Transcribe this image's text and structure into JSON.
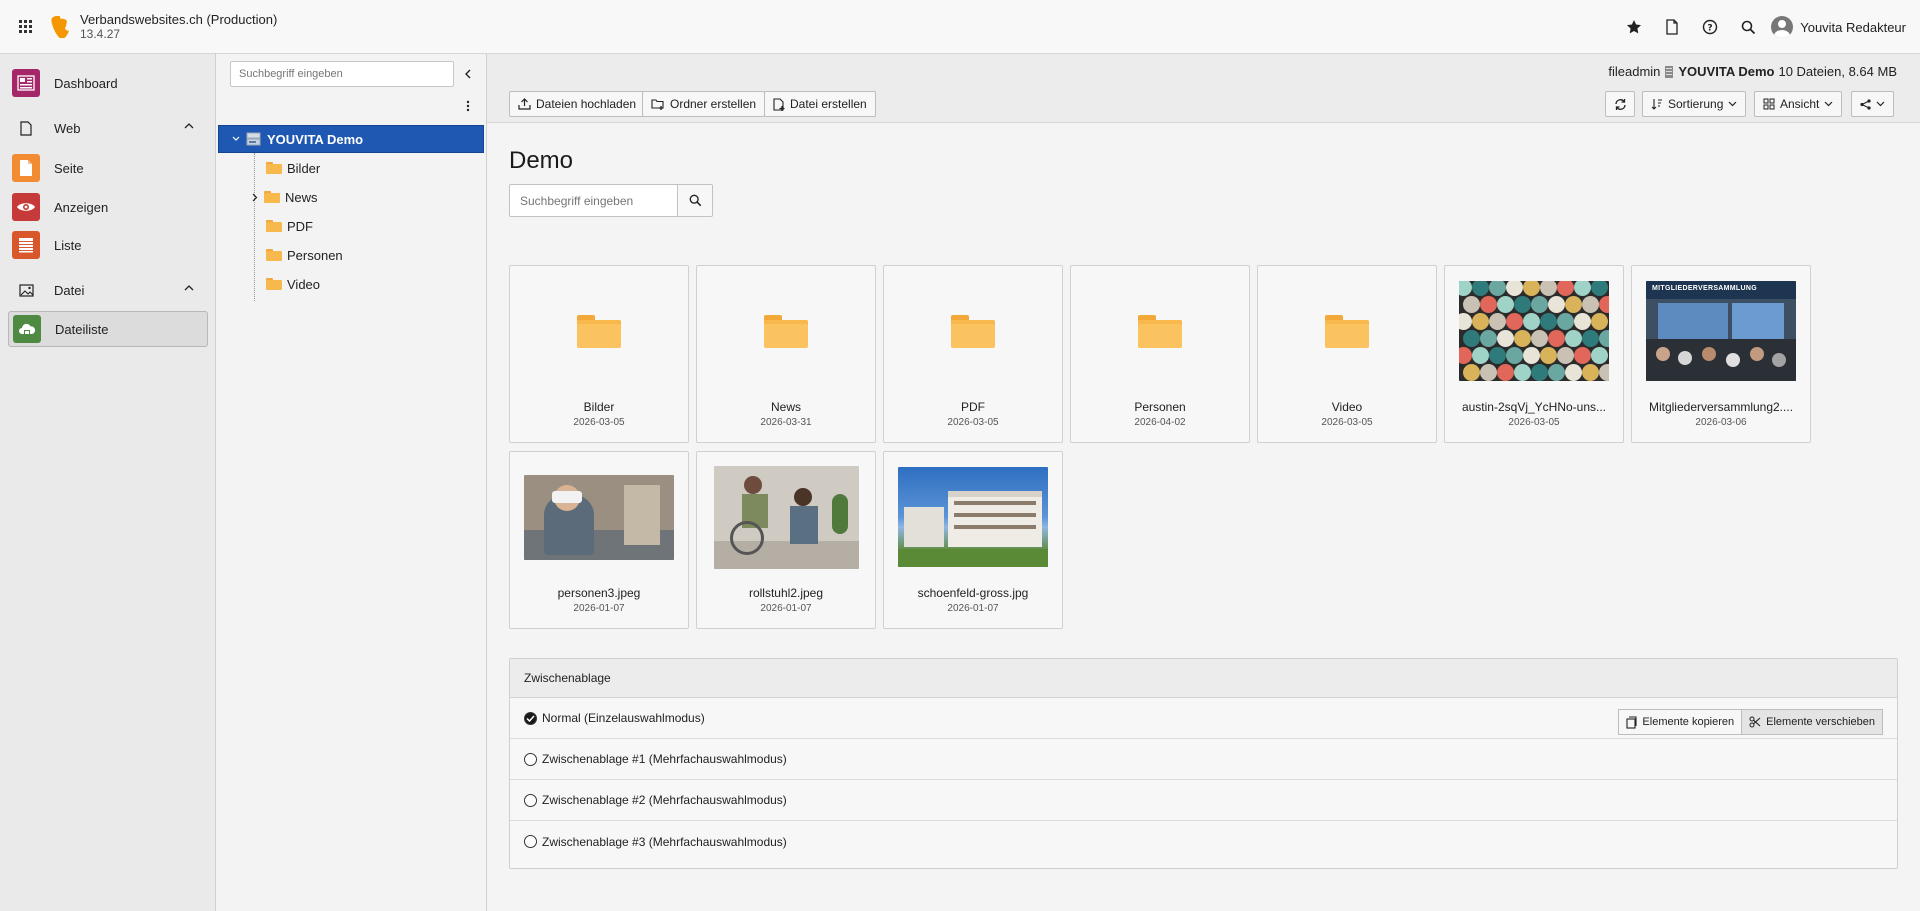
{
  "topbar": {
    "site_name": "Verbandswebsites.ch (Production)",
    "version": "13.4.27",
    "user_name": "Youvita Redakteur",
    "icons": [
      "bookmark-star-icon",
      "document-icon",
      "help-icon",
      "search-icon"
    ]
  },
  "modules": {
    "dashboard": "Dashboard",
    "web_group": "Web",
    "seite": "Seite",
    "anzeigen": "Anzeigen",
    "liste": "Liste",
    "datei_group": "Datei",
    "dateiliste": "Dateiliste",
    "colors": {
      "dashboard": "#a4276a",
      "seite": "#f28c32",
      "anzeigen": "#c63a3a",
      "liste": "#d9582b",
      "dateiliste": "#4f8a43"
    }
  },
  "tree": {
    "search_placeholder": "Suchbegriff eingeben",
    "root": "YOUVITA Demo",
    "folders": [
      "Bilder",
      "News",
      "PDF",
      "Personen",
      "Video"
    ]
  },
  "header": {
    "path_storage": "fileadmin",
    "path_folder": "YOUVITA Demo",
    "path_stats": "10 Dateien, 8.64 MB",
    "upload": "Dateien hochladen",
    "new_folder": "Ordner erstellen",
    "new_file": "Datei erstellen",
    "sort": "Sortierung",
    "view": "Ansicht"
  },
  "main": {
    "title": "Demo",
    "search_placeholder": "Suchbegriff eingeben",
    "items": [
      {
        "name": "Bilder",
        "date": "2026-03-05"
      },
      {
        "name": "News",
        "date": "2026-03-31"
      },
      {
        "name": "PDF",
        "date": "2026-03-05"
      },
      {
        "name": "Personen",
        "date": "2026-04-02"
      },
      {
        "name": "Video",
        "date": "2026-03-05"
      },
      {
        "name": "austin-2sqVj_YcHNo-uns...",
        "date": "2026-03-05"
      },
      {
        "name": "Mitgliederversammlung2....",
        "date": "2026-03-06"
      },
      {
        "name": "personen3.jpeg",
        "date": "2026-01-07"
      },
      {
        "name": "rollstuhl2.jpeg",
        "date": "2026-01-07"
      },
      {
        "name": "schoenfeld-gross.jpg",
        "date": "2026-01-07"
      }
    ],
    "meeting_banner": "MITGLIEDERVERSAMMLUNG"
  },
  "clipboard": {
    "title": "Zwischenablage",
    "normal": "Normal (Einzelauswahlmodus)",
    "copy": "Elemente kopieren",
    "move": "Elemente verschieben",
    "pad1": "Zwischenablage #1 (Mehrfachauswahlmodus)",
    "pad2": "Zwischenablage #2 (Mehrfachauswahlmodus)",
    "pad3": "Zwischenablage #3 (Mehrfachauswahlmodus)"
  }
}
